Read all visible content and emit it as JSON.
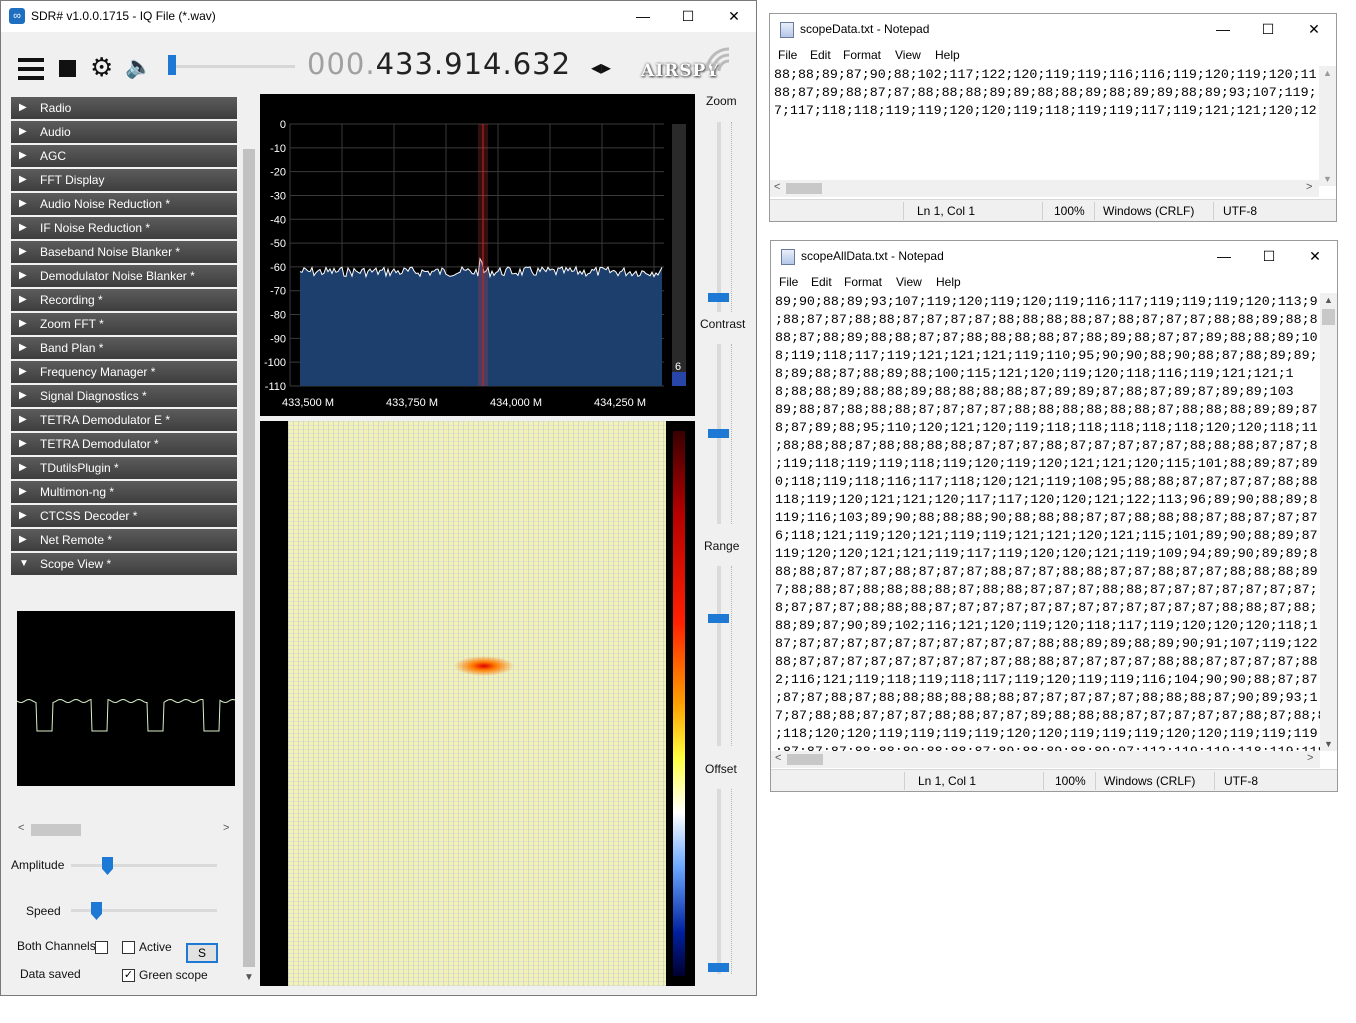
{
  "sdr": {
    "title": "SDR# v1.0.0.1715 - IQ File (*.wav)",
    "frequency_dim": "000.",
    "frequency_bright": "433.914.632",
    "tune_arrows": "◂▸",
    "logo": "AIRSPY",
    "window_controls": {
      "minimize": "—",
      "maximize": "☐",
      "close": "✕"
    },
    "side_items": [
      "Radio",
      "Audio",
      "AGC",
      "FFT Display",
      "Audio Noise Reduction *",
      "IF Noise Reduction *",
      "Baseband Noise Blanker *",
      "Demodulator Noise Blanker *",
      "Recording *",
      "Zoom FFT *",
      "Band Plan *",
      "Frequency Manager *",
      "Signal Diagnostics *",
      "TETRA Demodulator E *",
      "TETRA Demodulator *",
      "TDutilsPlugin *",
      "Multimon-ng *",
      "CTCSS Decoder *",
      "Net Remote *",
      "Scope View *"
    ],
    "scope_controls": {
      "amplitude_label": "Amplitude",
      "speed_label": "Speed",
      "both_channels_label": "Both Channels",
      "active_label": "Active",
      "s_button": "S",
      "data_saved_label": "Data saved",
      "green_scope_label": "Green scope",
      "green_scope_checked": "✓"
    },
    "spectrum": {
      "y_ticks": [
        "0",
        "-10",
        "-20",
        "-30",
        "-40",
        "-50",
        "-60",
        "-70",
        "-80",
        "-90",
        "-100",
        "-110"
      ],
      "x_ticks": [
        "433,500 M",
        "433,750 M",
        "434,000 M",
        "434,250 M"
      ],
      "level_value": "6",
      "fill_color": "#1d3f6e",
      "trace_color": "#ffffff"
    },
    "right_controls": {
      "zoom": "Zoom",
      "contrast": "Contrast",
      "range": "Range",
      "offset": "Offset"
    }
  },
  "notepad1": {
    "title": "scopeData.txt - Notepad",
    "menu": [
      "File",
      "Edit",
      "Format",
      "View",
      "Help"
    ],
    "lines": [
      "88;88;89;87;90;88;102;117;122;120;119;119;116;116;119;120;119;120;11",
      "88;87;89;88;87;87;88;88;88;89;89;88;88;89;88;89;89;88;89;93;107;119;",
      "7;117;118;118;119;119;120;120;119;118;119;119;117;119;121;121;120;12"
    ],
    "status": {
      "position": "Ln 1, Col 1",
      "zoom": "100%",
      "eol": "Windows (CRLF)",
      "encoding": "UTF-8"
    }
  },
  "notepad2": {
    "title": "scopeAllData.txt - Notepad",
    "menu": [
      "File",
      "Edit",
      "Format",
      "View",
      "Help"
    ],
    "lines": [
      "89;90;88;89;93;107;119;120;119;120;119;116;117;119;119;119;120;113;9",
      ";88;87;87;88;88;87;87;87;87;88;88;88;88;87;88;87;87;87;88;88;89;88;8",
      "88;87;88;89;88;88;87;87;88;88;88;88;87;88;89;88;87;87;89;88;88;89;10",
      "8;119;118;117;119;121;121;121;119;110;95;90;90;88;90;88;87;88;89;89;",
      "8;89;88;87;88;89;88;100;115;121;120;119;120;118;116;119;121;121;1",
      "8;88;88;89;88;88;89;88;88;88;88;87;89;89;87;88;87;89;87;89;89;103",
      "89;88;87;88;88;88;87;87;87;87;88;88;88;88;88;88;87;88;88;88;89;89;87",
      "8;87;89;88;95;110;120;121;120;119;118;118;118;118;118;120;120;118;11",
      ";88;88;88;87;88;88;88;88;87;87;87;88;87;87;87;87;87;88;88;88;87;87;8",
      ";119;118;119;119;118;119;120;119;120;121;121;120;115;101;88;89;87;89",
      "0;118;119;118;116;117;118;120;121;119;108;95;88;88;87;87;87;87;88;88",
      "118;119;120;121;121;120;117;117;120;120;121;122;113;96;89;90;88;89;8",
      "119;116;103;89;90;88;88;88;90;88;88;88;87;87;88;88;88;87;88;87;87;87",
      "6;118;121;119;120;121;119;119;121;121;120;121;115;101;89;90;88;89;87",
      "119;120;120;121;121;119;117;119;120;120;121;119;109;94;89;90;89;89;8",
      "88;88;87;87;87;88;87;87;87;88;87;87;88;88;87;87;88;87;87;88;88;88;89",
      "7;88;88;87;88;88;88;88;87;88;88;87;87;87;88;88;87;87;87;87;87;87;87;",
      "8;87;87;87;88;88;88;87;87;87;87;87;87;87;87;87;87;87;87;88;88;87;88;",
      "88;89;87;90;89;102;116;121;120;119;120;118;117;119;120;120;120;118;1",
      "87;87;87;87;87;87;87;87;87;87;87;88;88;89;89;88;89;90;91;107;119;122",
      "88;87;87;87;87;87;87;87;87;87;88;88;87;87;87;87;88;88;87;87;87;87;88",
      "2;116;121;119;118;119;118;117;119;120;119;119;116;104;90;90;88;87;87",
      ";87;87;88;87;88;88;88;88;88;88;87;87;87;87;87;88;88;88;87;90;89;93;1",
      "7;87;88;88;87;87;87;88;88;87;87;89;88;88;88;87;87;87;87;87;88;87;88;88;",
      ";118;120;120;119;119;119;119;120;120;119;119;119;120;120;119;119;119;119",
      ";87;87;87;88;88;89;88;88;87;89;88;89;88;89;97;112;119;119;118;119;118;1"
    ],
    "status": {
      "position": "Ln 1, Col 1",
      "zoom": "100%",
      "eol": "Windows (CRLF)",
      "encoding": "UTF-8"
    }
  }
}
